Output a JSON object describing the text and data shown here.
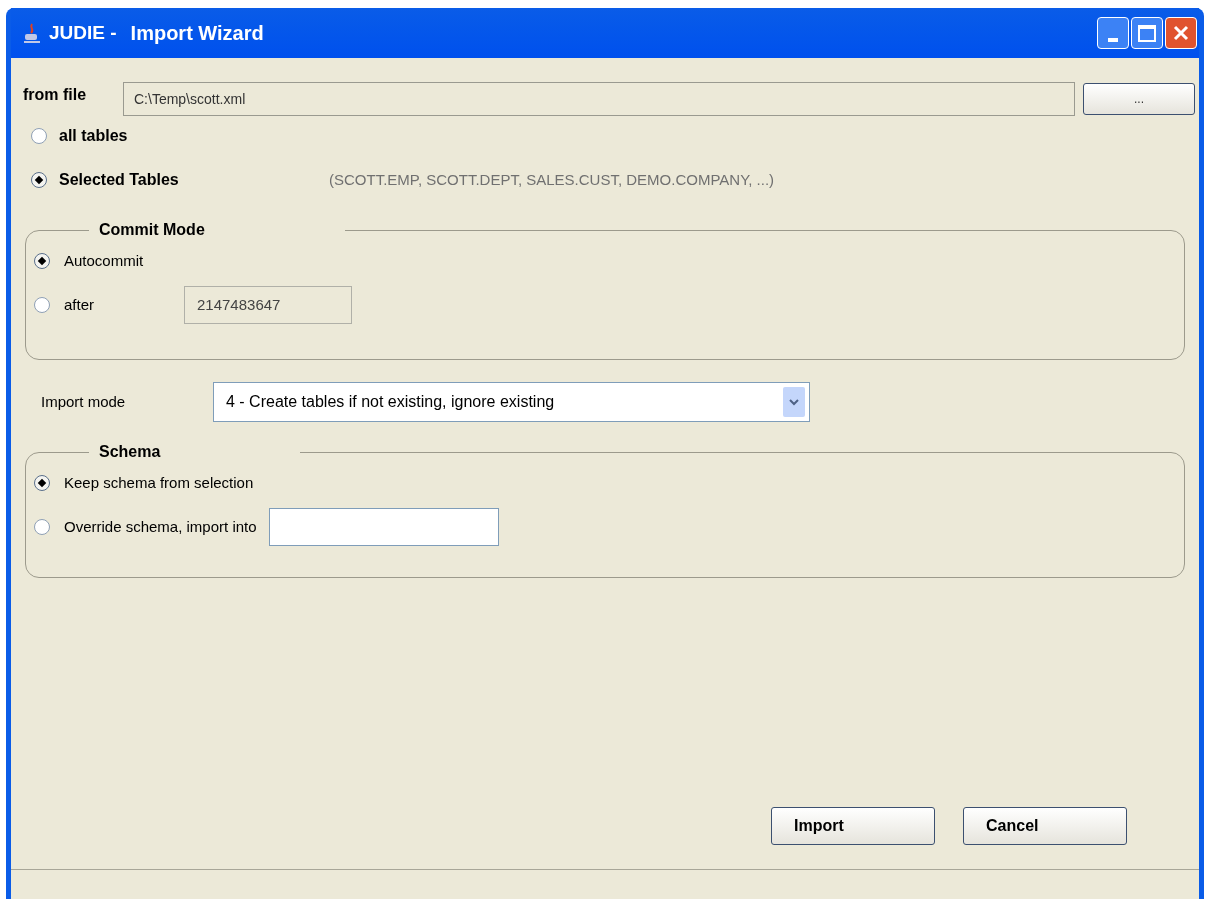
{
  "window": {
    "app_name": "JUDIE -",
    "title": "Import Wizard"
  },
  "source": {
    "label": "from file",
    "value": "C:\\Temp\\scott.xml",
    "browse_button": "..."
  },
  "table_scope": [
    {
      "label": "all tables",
      "selected": false
    },
    {
      "label": "Selected Tables",
      "selected": true,
      "detail": "(SCOTT.EMP, SCOTT.DEPT, SALES.CUST, DEMO.COMPANY, ...)"
    }
  ],
  "commit_mode": {
    "title": "Commit Mode",
    "options": [
      {
        "kind": "plain",
        "label": "Autocommit",
        "selected": true
      },
      {
        "kind": "input",
        "label": "after",
        "selected": false,
        "value": "2147483647",
        "disabled": true
      }
    ]
  },
  "import_mode": {
    "label": "Import mode",
    "value": "4 - Create tables if not existing, ignore existing"
  },
  "schema": {
    "title": "Schema",
    "options": [
      {
        "kind": "plain",
        "label": "Keep schema from selection",
        "selected": true
      },
      {
        "kind": "input",
        "label": "Override schema, import into",
        "selected": false,
        "disabled": false
      }
    ]
  },
  "buttons": [
    "Import",
    "Cancel"
  ]
}
